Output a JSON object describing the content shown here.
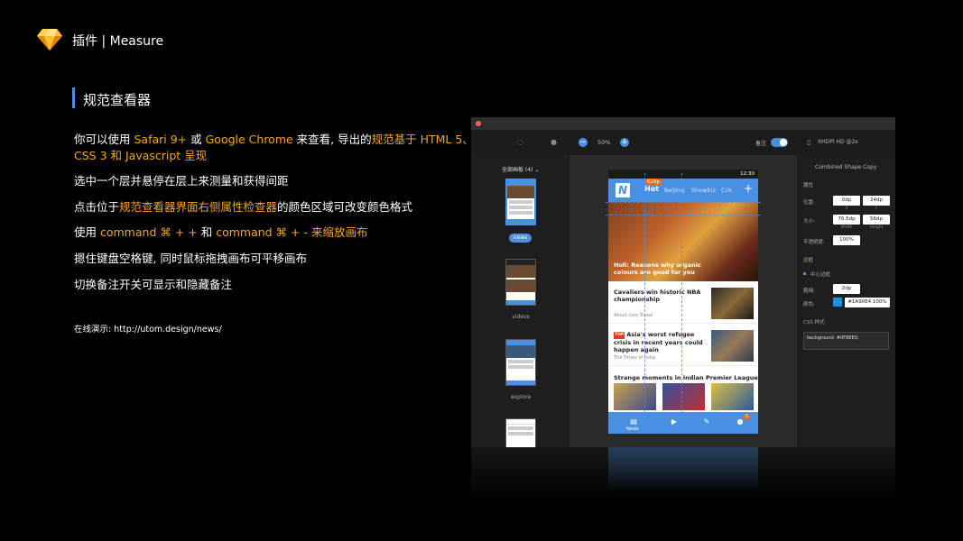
{
  "header": {
    "title": "插件 | Measure",
    "logo_icon": "sketch-diamond-icon"
  },
  "section": {
    "title": "规范查看器"
  },
  "lines": {
    "l1": {
      "p1": "你可以使用 ",
      "safari": "Safari 9+",
      "p2": " 或 ",
      "chrome": "Google Chrome",
      "p3": " 来查看, 导出的",
      "std": "规范基于 HTML 5、"
    },
    "l1b": {
      "css": "CSS 3 和 Javascript 呈现"
    },
    "l2": "选中一个层并悬停在层上来测量和获得间距",
    "l3": {
      "p1": "点击位于",
      "hl": "规范查看器界面右侧属性检查器",
      "p2": "的颜色区域可改变颜色格式"
    },
    "l4": {
      "p1": "使用 ",
      "hl1": "command ⌘ + + ",
      "p2": "和 ",
      "hl2": "command ⌘ + - ",
      "hl3": "来缩放画布"
    },
    "l5": "摁住键盘空格键, 同时鼠标拖拽画布可平移画布",
    "l6": "切换备注开关可显示和隐藏备注",
    "demo": "在线演示: http://utom.design/news/"
  },
  "app": {
    "toolbar": {
      "zoom": "50%",
      "notes_label": "备注",
      "device": "XHDPI HD @2x"
    },
    "sidebar": {
      "header": "全部画板 (4) ⌄",
      "artboards": [
        "news",
        "videos",
        "explore",
        ""
      ]
    },
    "phone": {
      "status_time": "12:30",
      "logo": "N",
      "tabs": [
        "Hot",
        "Beijing",
        "Showbiz",
        "Cric"
      ],
      "measure_badge": "62dp",
      "hero_caption": "Holi: Reasons why organic colours are good for you",
      "stories": [
        {
          "title": "Cavaliers win historic NBA championship",
          "source": "About.com Travel",
          "badge": ""
        },
        {
          "title": "Asia's worst refugee crisis in recent years could happen again",
          "source": "The Times of India",
          "badge": "TOP"
        }
      ],
      "grid_title": "Strange moments in Indian Premier League",
      "bottom_label": "News",
      "bottom_count": "5"
    },
    "inspector": {
      "title": "Combined Shape Copy",
      "props_label": "属性",
      "position_label": "位置:",
      "x": "0dp",
      "y": "24dp",
      "x_sub": "X",
      "y_sub": "Y",
      "size_label": "大小:",
      "width": "76.5dp",
      "height": "56dp",
      "width_sub": "Width",
      "height_sub": "Height",
      "opacity_label": "不透明度:",
      "opacity": "100%",
      "border_label": "边框",
      "border_item": "中心边框",
      "thickness_label": "粗细:",
      "thickness": "2dp",
      "color_label": "颜色:",
      "color": "#1A90E4 100%",
      "css_label": "CSS 样式",
      "css": "background: #0F88E0;"
    }
  },
  "colors": {
    "accent": "#f5a623",
    "blue": "#4a90e2",
    "background": "#000000",
    "measure_orange": "#f5691d",
    "swatch": "#1A90E4"
  }
}
